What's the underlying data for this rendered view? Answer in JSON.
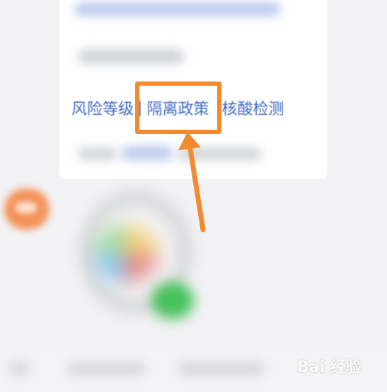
{
  "menu": {
    "risk_level": "风险等级",
    "divider": "|",
    "quarantine_policy": "隔离政策",
    "nucleic_test": "核酸检测"
  },
  "watermark": {
    "text": "Bai  经验"
  },
  "colors": {
    "link_blue": "#3f6bc4",
    "highlight_orange": "#f28a30",
    "background": "#f2f2f4"
  }
}
